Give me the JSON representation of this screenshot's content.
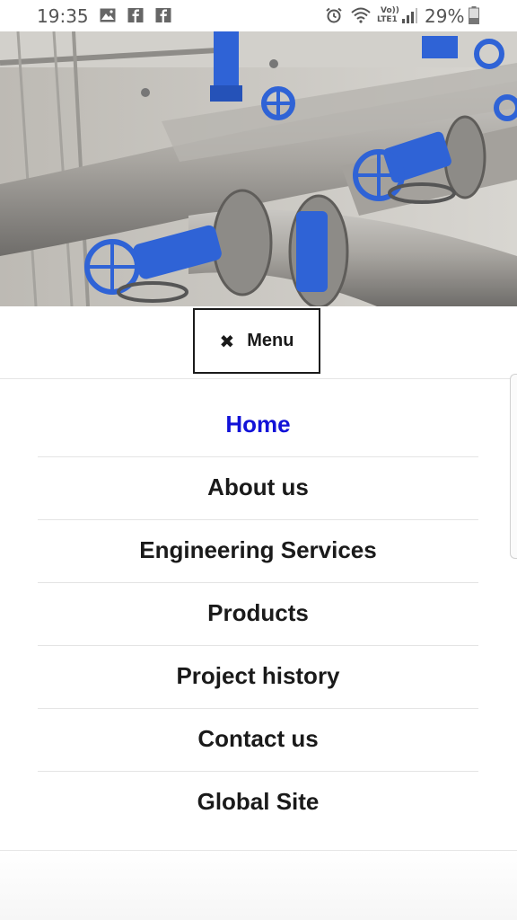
{
  "status_bar": {
    "time": "19:35",
    "battery": "29%",
    "network_label_top": "Vo))",
    "network_label_bottom": "LTE1",
    "icons": [
      "image-icon",
      "facebook-icon",
      "facebook-icon",
      "alarm-icon",
      "wifi-icon",
      "signal-icon",
      "battery-icon"
    ]
  },
  "hero": {
    "image": "industrial-pipes-with-blue-valves",
    "accent_color": "#2f63d6"
  },
  "menu": {
    "label": "Menu",
    "close_glyph": "✖"
  },
  "nav": {
    "items": [
      {
        "label": "Home",
        "active": true
      },
      {
        "label": "About us",
        "active": false
      },
      {
        "label": "Engineering Services",
        "active": false
      },
      {
        "label": "Products",
        "active": false
      },
      {
        "label": "Project history",
        "active": false
      },
      {
        "label": "Contact us",
        "active": false
      },
      {
        "label": "Global Site",
        "active": false
      }
    ],
    "active_color": "#1212d8",
    "text_color": "#1a1a1a"
  }
}
